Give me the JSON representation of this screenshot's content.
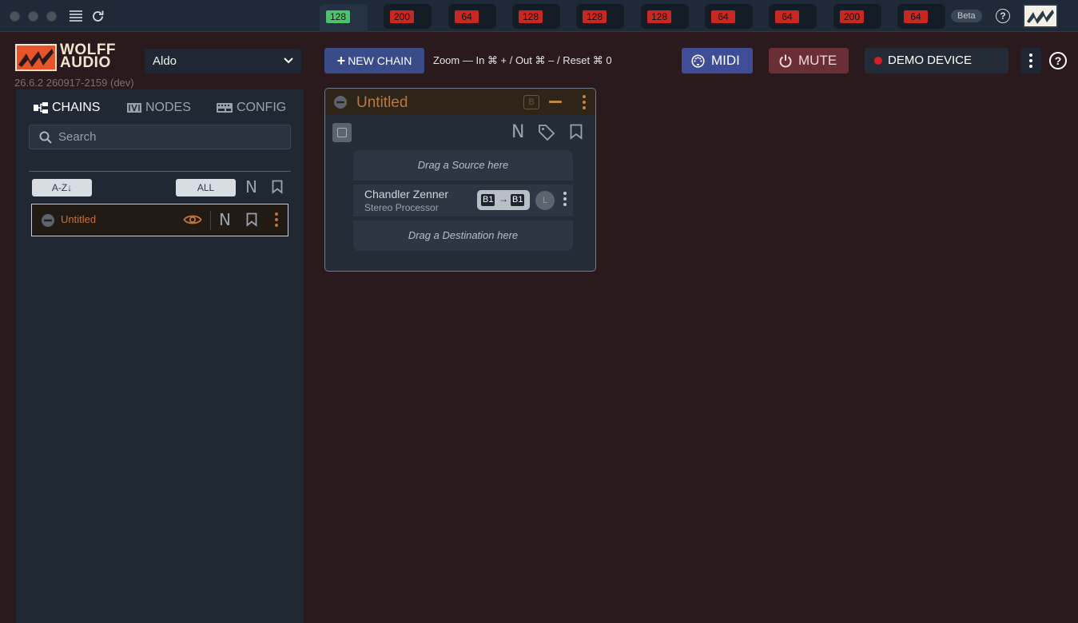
{
  "titlebar": {
    "buffers": [
      {
        "value": "128",
        "status": "ok"
      },
      {
        "value": "200",
        "status": "warn"
      },
      {
        "value": "64",
        "status": "warn"
      },
      {
        "value": "128",
        "status": "warn"
      },
      {
        "value": "128",
        "status": "warn"
      },
      {
        "value": "128",
        "status": "warn"
      },
      {
        "value": "64",
        "status": "warn"
      },
      {
        "value": "64",
        "status": "warn"
      },
      {
        "value": "200",
        "status": "warn"
      },
      {
        "value": "64",
        "status": "warn"
      }
    ],
    "beta_label": "Beta",
    "help_glyph": "?"
  },
  "header": {
    "brand_line1": "WOLFF",
    "brand_line2": "AUDIO",
    "version": "26.6.2 260917-2159 (dev)",
    "device": "Aldo",
    "new_chain_label": "NEW CHAIN",
    "zoom_hint": "Zoom — In ⌘ + / Out ⌘ – / Reset ⌘ 0",
    "midi_label": "MIDI",
    "mute_label": "MUTE",
    "demo_label": "DEMO DEVICE",
    "help_glyph": "?"
  },
  "sidebar": {
    "tabs": [
      {
        "label": "CHAINS",
        "icon": "chains-icon"
      },
      {
        "label": "NODES",
        "icon": "nodes-icon"
      },
      {
        "label": "CONFIG",
        "icon": "config-icon"
      }
    ],
    "search_placeholder": "Search",
    "sort_label": "A-Z↓",
    "filter_label": "ALL",
    "n_glyph": "N",
    "chains": [
      {
        "name": "Untitled"
      }
    ]
  },
  "chain_card": {
    "title": "Untitled",
    "b_label": "B",
    "n_glyph": "N",
    "source_hint": "Drag a Source here",
    "destination_hint": "Drag a Destination here",
    "node": {
      "name": "Chandler Zenner",
      "type": "Stereo Processor",
      "route_in": "B1",
      "route_arrow": "→",
      "route_out": "B1",
      "l_label": "L"
    }
  },
  "colors": {
    "background": "#2a1a1e",
    "panel": "#1f2833",
    "accent_orange": "#c1733a",
    "midi_blue": "#3f4d96",
    "mute_red": "#6a2f35",
    "buffer_ok": "#4ac46a",
    "buffer_warn": "#c92821"
  }
}
